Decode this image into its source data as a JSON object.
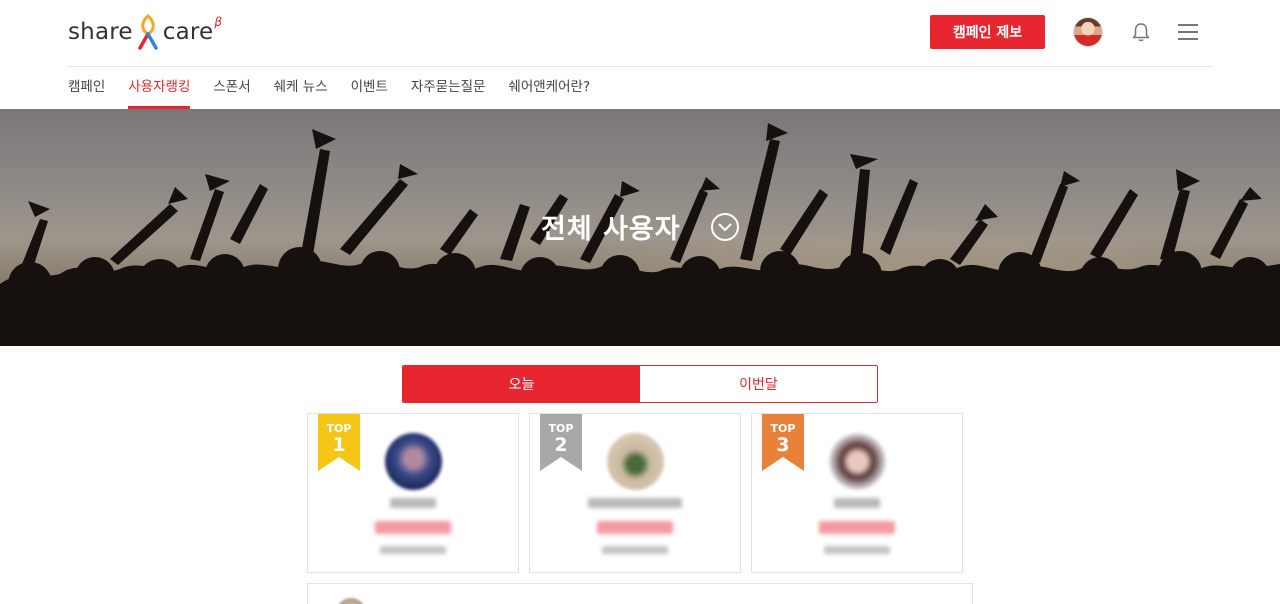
{
  "header": {
    "logo_word1": "share",
    "logo_word2": "care",
    "logo_beta": "β",
    "report_button": "캠페인 제보",
    "icons": {
      "avatar": "user-avatar",
      "bell": "bell-icon",
      "menu": "hamburger-menu-icon"
    }
  },
  "nav": {
    "items": [
      {
        "label": "캠페인",
        "active": false
      },
      {
        "label": "사용자랭킹",
        "active": true
      },
      {
        "label": "스폰서",
        "active": false
      },
      {
        "label": "쉐케 뉴스",
        "active": false
      },
      {
        "label": "이벤트",
        "active": false
      },
      {
        "label": "자주묻는질문",
        "active": false
      },
      {
        "label": "쉐어앤케어란?",
        "active": false
      }
    ]
  },
  "hero": {
    "title": "전체 사용자",
    "dropdown_icon": "chevron-down-circle-icon"
  },
  "tabs": [
    {
      "label": "오늘",
      "active": true
    },
    {
      "label": "이번달",
      "active": false
    }
  ],
  "ranking": [
    {
      "badge_top": "TOP",
      "rank": "1",
      "badge_color": "#f5c518"
    },
    {
      "badge_top": "TOP",
      "rank": "2",
      "badge_color": "#a8a8a8"
    },
    {
      "badge_top": "TOP",
      "rank": "3",
      "badge_color": "#e8813a"
    }
  ],
  "colors": {
    "accent": "#e8262f"
  }
}
